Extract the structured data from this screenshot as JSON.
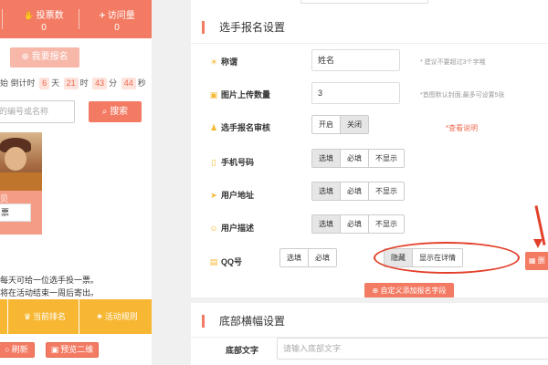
{
  "preview": {
    "stats": [
      {
        "icon": "thumbs-up-icon",
        "glyph": "✋",
        "label": "投票数",
        "value": "0"
      },
      {
        "icon": "send-icon",
        "glyph": "✈",
        "label": "访问量",
        "value": "0"
      }
    ],
    "signup_button": "我要报名",
    "countdown": {
      "prefix": "始",
      "label": "倒计时",
      "days": "6",
      "days_unit": "天",
      "hours": "21",
      "hours_unit": "时",
      "minutes": "43",
      "minutes_unit": "分",
      "seconds": "44",
      "seconds_unit": "秒"
    },
    "search": {
      "placeholder": "的编号或名称",
      "button": "搜索"
    },
    "contestant": {
      "name": "贝",
      "vote_button": "票"
    },
    "notice_lines": [
      "每天可给一位选手投一票。",
      "将在活动结束一周后寄出。"
    ],
    "bottom_nav": [
      {
        "icon": "trophy-icon",
        "glyph": "♛",
        "label": "当前排名"
      },
      {
        "icon": "rules-icon",
        "glyph": "✷",
        "label": "活动规则"
      }
    ],
    "footer_buttons": [
      {
        "icon": "refresh-icon",
        "glyph": "○",
        "label": "刷新"
      },
      {
        "icon": "qrcode-icon",
        "glyph": "▣",
        "label": "预览二维码"
      }
    ]
  },
  "panel": {
    "section1_title": "选手报名设置",
    "rows": {
      "title": {
        "label": "称谓",
        "icon": "sun-icon",
        "glyph": "☀",
        "value": "姓名",
        "hint": "* 建议不要超过3个字哦"
      },
      "image_count": {
        "label": "图片上传数量",
        "icon": "image-icon",
        "glyph": "▣",
        "value": "3",
        "hint": "*首图默认封面,最多可设置5张"
      },
      "review": {
        "label": "选手报名审核",
        "icon": "user-icon",
        "glyph": "♟",
        "options": [
          "开启",
          "关闭"
        ],
        "link": "*查看说明"
      },
      "phone": {
        "label": "手机号码",
        "icon": "phone-icon",
        "glyph": "▯",
        "options": [
          "选填",
          "必填",
          "不显示"
        ]
      },
      "address": {
        "label": "用户地址",
        "icon": "location-icon",
        "glyph": "➤",
        "options": [
          "选填",
          "必填",
          "不显示"
        ]
      },
      "desc": {
        "label": "用户描述",
        "icon": "smile-icon",
        "glyph": "☺",
        "options": [
          "选填",
          "必填",
          "不显示"
        ]
      },
      "qq": {
        "label": "QQ号",
        "icon": "document-icon",
        "glyph": "▤",
        "options": [
          "选填",
          "必填"
        ],
        "display_options": [
          "隐藏",
          "显示在详情"
        ]
      }
    },
    "custom_field_button": "自定义添加报名字段",
    "side_button": "删",
    "section2_title": "底部横幅设置",
    "banner_label": "底部文字",
    "banner_placeholder": "请输入底部文字"
  },
  "colors": {
    "accent": "#f37b63",
    "yellow": "#f7b733",
    "highlight": "#e3402a"
  }
}
